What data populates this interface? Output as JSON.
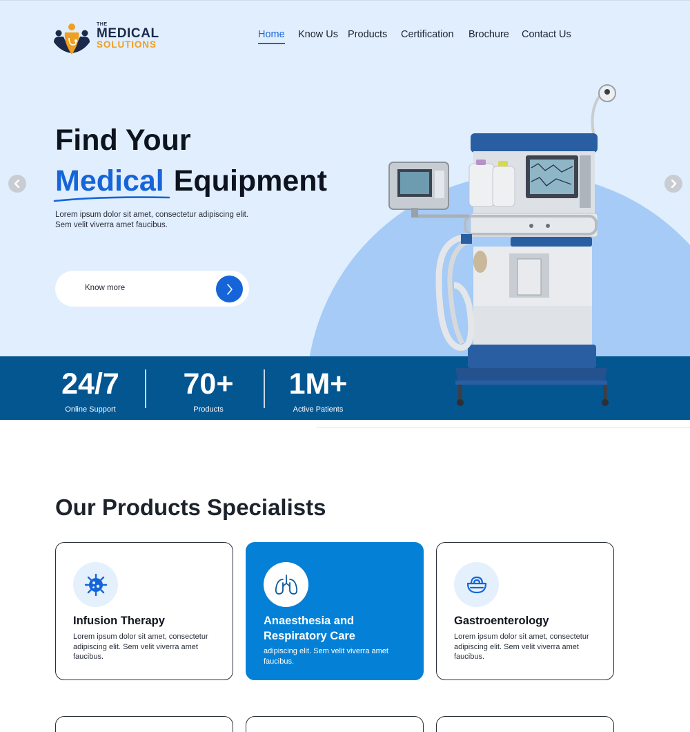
{
  "brand": {
    "the": "THE",
    "medical": "MEDICAL",
    "solutions": "SOLUTIONS",
    "colors": {
      "navy": "#1b2a4a",
      "orange": "#f0a020",
      "accent": "#1565d8"
    }
  },
  "nav": {
    "items": [
      {
        "label": "Home",
        "active": true
      },
      {
        "label": "Know Us"
      },
      {
        "label": "Products"
      },
      {
        "label": "Certification"
      },
      {
        "label": "Brochure"
      },
      {
        "label": "Contact Us"
      }
    ]
  },
  "hero": {
    "title_line1": "Find Your",
    "title_highlight": "Medical",
    "title_rest": "Equipment",
    "lead": "Lorem ipsum dolor sit amet, consectetur adipiscing elit. Sem velit viverra amet faucibus.",
    "cta_label": "Know more",
    "prev_icon": "chevron-left-icon",
    "next_icon": "chevron-right-icon"
  },
  "stats": [
    {
      "value": "24/7",
      "label": "Online Support"
    },
    {
      "value": "70+",
      "label": "Products"
    },
    {
      "value": "1M+",
      "label": "Active Patients"
    }
  ],
  "products": {
    "title": "Our Products Specialists",
    "cards": [
      {
        "title": "Infusion Therapy",
        "text": "Lorem ipsum dolor sit amet, consectetur adipiscing elit. Sem velit viverra amet faucibus.",
        "icon": "virus-icon"
      },
      {
        "title": "Anaesthesia and Respiratory Care",
        "text": "adipiscing elit. Sem velit viverra amet faucibus.",
        "icon": "lungs-icon",
        "featured": true
      },
      {
        "title": "Gastroenterology",
        "text": "Lorem ipsum dolor sit amet, consectetur adipiscing elit. Sem velit viverra amet faucibus.",
        "icon": "stomach-icon"
      }
    ]
  }
}
